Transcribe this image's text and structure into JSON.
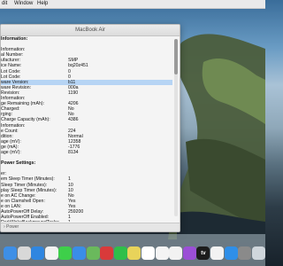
{
  "menubar": {
    "items": [
      "dit",
      "Window",
      "Help"
    ]
  },
  "window": {
    "title": "MacBook Air",
    "status": "› Power",
    "rows": [
      {
        "k": "Information:",
        "v": "",
        "bold": true
      },
      {
        "k": "",
        "v": ""
      },
      {
        "k": "Information:",
        "v": ""
      },
      {
        "k": "al Number:",
        "v": ""
      },
      {
        "k": "ufacturer:",
        "v": "SMP"
      },
      {
        "k": "ice Name:",
        "v": "bq20z451"
      },
      {
        "k": "Lot Code:",
        "v": "0"
      },
      {
        "k": "Lot Code:",
        "v": "0"
      },
      {
        "k": "ware Version:",
        "v": "b11",
        "sel": true
      },
      {
        "k": "ware Revision:",
        "v": "000a"
      },
      {
        "k": "Revision:",
        "v": "1190"
      },
      {
        "k": "Information:",
        "v": ""
      },
      {
        "k": "ge Remaining (mAh):",
        "v": "4206"
      },
      {
        "k": "Charged:",
        "v": "No"
      },
      {
        "k": "rging:",
        "v": "No"
      },
      {
        "k": "Charge Capacity (mAh):",
        "v": "4386"
      },
      {
        "k": "Information:",
        "v": ""
      },
      {
        "k": "e Count:",
        "v": "224"
      },
      {
        "k": "dition:",
        "v": "Normal"
      },
      {
        "k": "age (mV):",
        "v": "12358"
      },
      {
        "k": "ge (mA):",
        "v": "-1776"
      },
      {
        "k": "age (mV):",
        "v": "8134"
      },
      {
        "k": "",
        "v": ""
      },
      {
        "k": "Power Settings:",
        "v": "",
        "bold": true
      },
      {
        "k": "",
        "v": ""
      },
      {
        "k": "er:",
        "v": ""
      },
      {
        "k": "em Sleep Timer (Minutes):",
        "v": "1"
      },
      {
        "k": "Sleep Timer (Minutes):",
        "v": "10"
      },
      {
        "k": "play Sleep Timer (Minutes):",
        "v": "10"
      },
      {
        "k": "e on AC Change:",
        "v": "No"
      },
      {
        "k": "e on Clamshell Open:",
        "v": "Yes"
      },
      {
        "k": "e on LAN:",
        "v": "Yes"
      },
      {
        "k": "AutoPowerOff Delay:",
        "v": "259200"
      },
      {
        "k": "AutoPowerOff Enabled:",
        "v": "1"
      },
      {
        "k": "DarkWakeBackgroundTasks:",
        "v": "1"
      },
      {
        "k": "Display Sleep Uses Dim:",
        "v": "Yes"
      }
    ]
  },
  "dock": {
    "icons": [
      {
        "name": "finder-icon",
        "color": "#3e8fe6"
      },
      {
        "name": "launchpad-icon",
        "color": "#d8d8d8"
      },
      {
        "name": "safari-icon",
        "color": "#2f86e0"
      },
      {
        "name": "photos-icon",
        "color": "#f2f2f2"
      },
      {
        "name": "messages-icon",
        "color": "#3ecf4a"
      },
      {
        "name": "mail-icon",
        "color": "#3a8de8"
      },
      {
        "name": "maps-icon",
        "color": "#6ab95c"
      },
      {
        "name": "photobooth-icon",
        "color": "#d93a3a"
      },
      {
        "name": "facetime-icon",
        "color": "#2fbf4a"
      },
      {
        "name": "notes-icon",
        "color": "#e8d35a"
      },
      {
        "name": "calendar-icon",
        "color": "#ffffff"
      },
      {
        "name": "reminders-icon",
        "color": "#f4f4f4"
      },
      {
        "name": "music-icon",
        "color": "#f2f2f2"
      },
      {
        "name": "podcasts-icon",
        "color": "#9b4fd6"
      },
      {
        "name": "appletv-icon",
        "color": "#1c1c1c"
      },
      {
        "name": "news-icon",
        "color": "#f2f2f2"
      },
      {
        "name": "app-store-icon",
        "color": "#2f8fe8"
      },
      {
        "name": "system-preferences-icon",
        "color": "#8a8a8a"
      },
      {
        "name": "trash-icon",
        "color": "#cfd6dc"
      }
    ],
    "tv_label": "tv"
  }
}
